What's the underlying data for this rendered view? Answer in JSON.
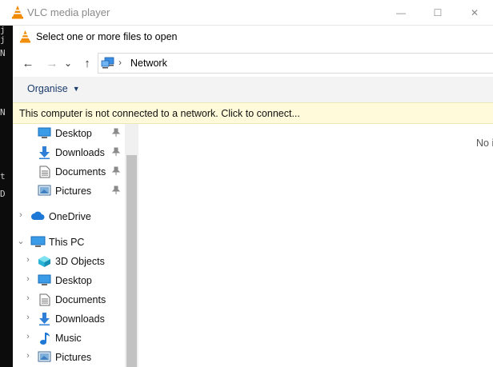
{
  "background": {
    "terminal_fragments": [
      "a",
      "j",
      "j",
      "N",
      "N",
      "t",
      "D"
    ]
  },
  "vlc": {
    "title": "VLC media player",
    "minimize": "—",
    "maximize": "☐",
    "close": "✕"
  },
  "dialog": {
    "title": "Select one or more files to open"
  },
  "nav": {
    "back": "←",
    "forward": "→",
    "recent": "⌄",
    "up": "↑",
    "separator": "›",
    "breadcrumb": "Network"
  },
  "toolbar": {
    "organise_label": "Organise",
    "organise_caret": "▼"
  },
  "infobar": {
    "message": "This computer is not connected to a network. Click to connect..."
  },
  "sidebar": {
    "quick_access": [
      {
        "label": "Desktop",
        "icon": "desktop-icon",
        "pinned": true
      },
      {
        "label": "Downloads",
        "icon": "downloads-icon",
        "pinned": true
      },
      {
        "label": "Documents",
        "icon": "documents-icon",
        "pinned": true
      },
      {
        "label": "Pictures",
        "icon": "pictures-icon",
        "pinned": true
      }
    ],
    "onedrive": {
      "label": "OneDrive",
      "icon": "cloud-icon"
    },
    "this_pc": {
      "label": "This PC",
      "icon": "computer-icon"
    },
    "this_pc_items": [
      {
        "label": "3D Objects",
        "icon": "3d-objects-icon"
      },
      {
        "label": "Desktop",
        "icon": "desktop-icon"
      },
      {
        "label": "Documents",
        "icon": "documents-icon"
      },
      {
        "label": "Downloads",
        "icon": "downloads-icon"
      },
      {
        "label": "Music",
        "icon": "music-icon"
      },
      {
        "label": "Pictures",
        "icon": "pictures-icon"
      }
    ],
    "pin_glyph": "📌",
    "expand_glyph": "›",
    "expanded_glyph": "⌄"
  },
  "main": {
    "empty_text": "No i"
  },
  "colors": {
    "accent": "#1a3a6b",
    "infobar_bg": "#fffad9",
    "vlc_orange": "#f08a00"
  }
}
